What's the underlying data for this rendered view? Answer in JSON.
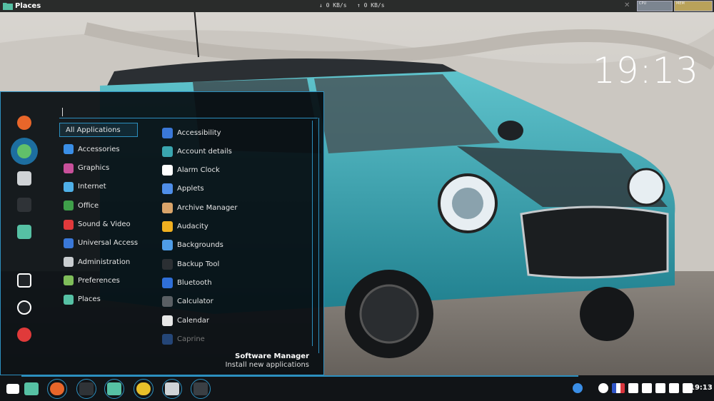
{
  "top_panel": {
    "title": "Places",
    "net_down": "↓ 0 KB/s",
    "net_up": "↑ 0 KB/s",
    "close_glyph": "✕",
    "cpu_label": "CPU",
    "mem_label": "MEM"
  },
  "desktop": {
    "clock": "19:13"
  },
  "menu": {
    "sidebar": [
      {
        "name": "firefox-icon",
        "color": "#e8662a"
      },
      {
        "name": "apps-grid-icon",
        "color": "#61c06a",
        "selected": true
      },
      {
        "name": "settings-toggle-icon",
        "color": "#cfd3d6"
      },
      {
        "name": "terminal-icon",
        "color": "#2f3337"
      },
      {
        "name": "folder-icon",
        "color": "#56c1a4"
      },
      {
        "name": "lock-icon",
        "color": "#202428"
      },
      {
        "name": "logout-icon",
        "color": "#202428"
      },
      {
        "name": "power-icon",
        "color": "#e03a3a"
      }
    ],
    "categories": [
      {
        "label": "All Applications",
        "icon": "none",
        "color": ""
      },
      {
        "label": "Accessories",
        "icon": "accessories-icon",
        "color": "#3a8ee6"
      },
      {
        "label": "Graphics",
        "icon": "graphics-icon",
        "color": "#c8509a"
      },
      {
        "label": "Internet",
        "icon": "internet-icon",
        "color": "#4fb0e8"
      },
      {
        "label": "Office",
        "icon": "office-icon",
        "color": "#3fa04a"
      },
      {
        "label": "Sound & Video",
        "icon": "media-icon",
        "color": "#e0393b"
      },
      {
        "label": "Universal Access",
        "icon": "accessibility-icon",
        "color": "#3a78d8"
      },
      {
        "label": "Administration",
        "icon": "administration-icon",
        "color": "#c9cdd0"
      },
      {
        "label": "Preferences",
        "icon": "preferences-icon",
        "color": "#7fbd5a"
      },
      {
        "label": "Places",
        "icon": "places-icon",
        "color": "#56c1a4"
      }
    ],
    "applications": [
      {
        "label": "Accessibility",
        "icon": "accessibility-icon",
        "color": "#3a78d8"
      },
      {
        "label": "Account details",
        "icon": "account-icon",
        "color": "#3aa6b0"
      },
      {
        "label": "Alarm Clock",
        "icon": "alarm-clock-icon",
        "color": "#ffffff"
      },
      {
        "label": "Applets",
        "icon": "applets-icon",
        "color": "#4f8ee8"
      },
      {
        "label": "Archive Manager",
        "icon": "archive-icon",
        "color": "#d9a46a"
      },
      {
        "label": "Audacity",
        "icon": "audacity-icon",
        "color": "#f0b020"
      },
      {
        "label": "Backgrounds",
        "icon": "backgrounds-icon",
        "color": "#4f9de8"
      },
      {
        "label": "Backup Tool",
        "icon": "backup-icon",
        "color": "#2b2f33"
      },
      {
        "label": "Bluetooth",
        "icon": "bluetooth-icon",
        "color": "#2f6fd8"
      },
      {
        "label": "Calculator",
        "icon": "calculator-icon",
        "color": "#5a5f64"
      },
      {
        "label": "Calendar",
        "icon": "calendar-icon",
        "color": "#e8e8e8"
      },
      {
        "label": "Caprine",
        "icon": "caprine-icon",
        "color": "#3a78d8",
        "dim": true
      }
    ],
    "software_manager": {
      "title": "Software Manager",
      "subtitle": "Install new applications"
    }
  },
  "taskbar": {
    "items": [
      {
        "name": "zorin-menu-icon",
        "color": "#ffffff"
      },
      {
        "name": "folder-window-icon",
        "color": "#56c1a4"
      },
      {
        "name": "firefox-icon",
        "color": "#e8662a"
      },
      {
        "name": "terminal-icon",
        "color": "#2f3337"
      },
      {
        "name": "files-icon",
        "color": "#56c1a4"
      },
      {
        "name": "chrome-icon",
        "color": "#e8c02a"
      },
      {
        "name": "settings-icon",
        "color": "#cfd3d6"
      },
      {
        "name": "media-player-icon",
        "color": "#3a3f44"
      }
    ],
    "tray": [
      "bluetooth-icon",
      "clock-icon",
      "keyboard-layout-flag-icon",
      "clipboard-icon",
      "user-icon",
      "network-icon",
      "volume-icon",
      "battery-icon"
    ],
    "time": "19:13"
  }
}
